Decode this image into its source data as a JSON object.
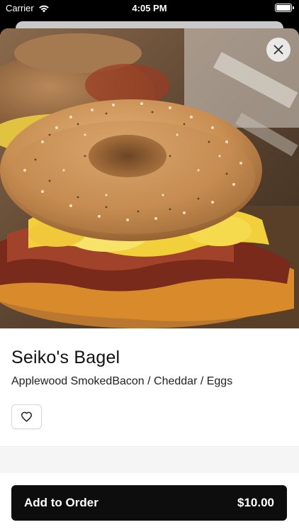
{
  "status_bar": {
    "carrier": "Carrier",
    "time": "4:05 PM"
  },
  "item": {
    "image_icon": "bagel-sandwich-photo",
    "name": "Seiko's Bagel",
    "description": "Applewood SmokedBacon / Cheddar / Eggs"
  },
  "actions": {
    "close_icon": "close-icon",
    "favorite_icon": "heart-outline-icon",
    "add_to_order_label": "Add to Order",
    "price": "$10.00"
  },
  "colors": {
    "primary_button": "#0d0d0d",
    "background": "#ffffff"
  }
}
